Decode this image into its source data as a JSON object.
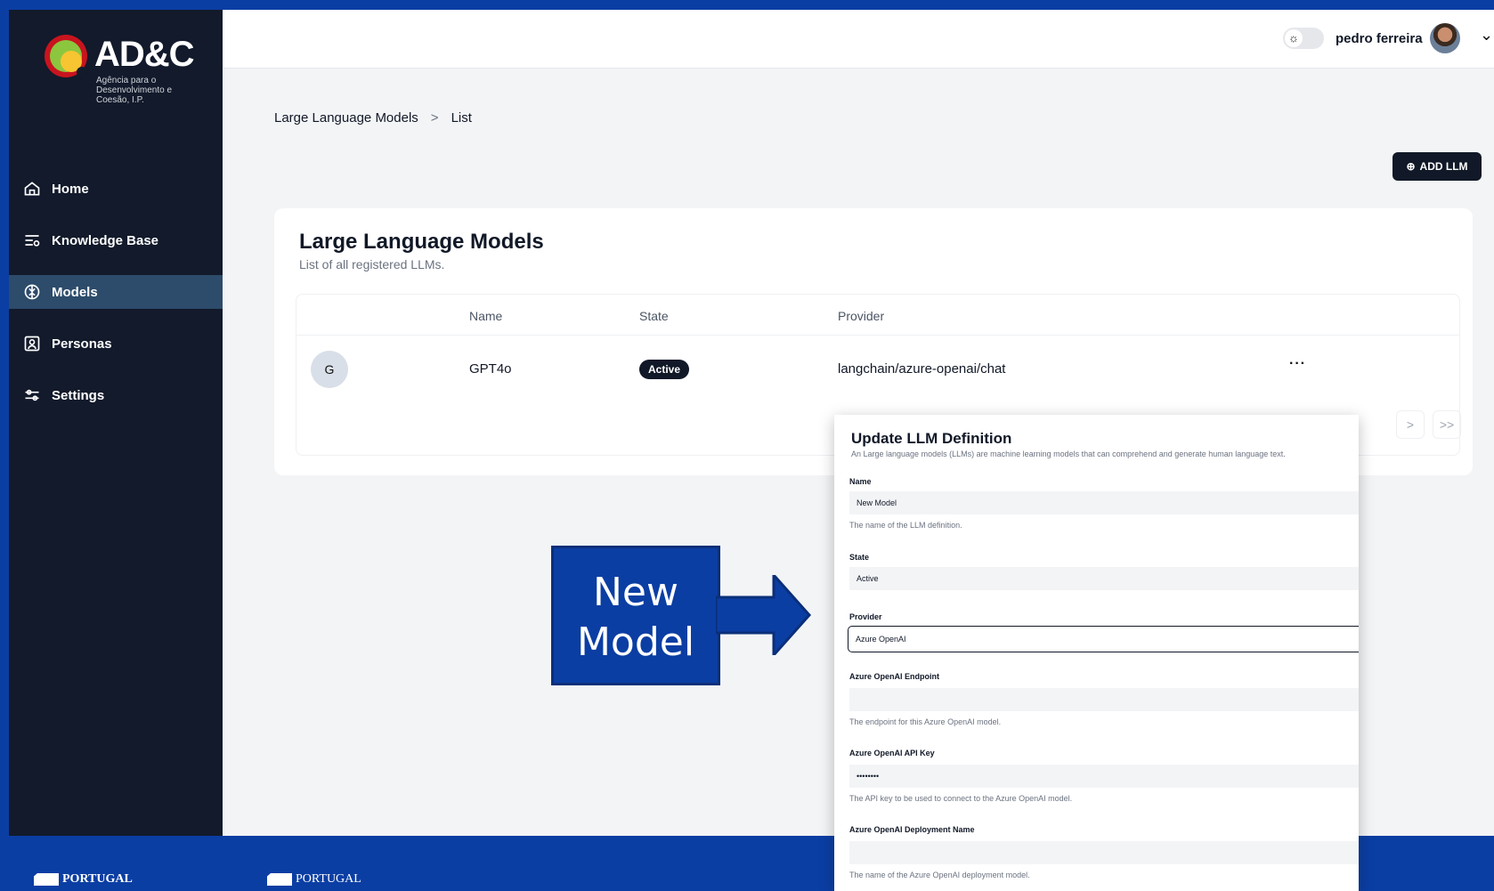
{
  "logo": {
    "name": "AD&C",
    "subtitle": "Agência para o Desenvolvimento e Coesão, I.P."
  },
  "sidebar": {
    "items": [
      {
        "label": "Home",
        "icon": "home-icon"
      },
      {
        "label": "Knowledge Base",
        "icon": "search-list-icon"
      },
      {
        "label": "Models",
        "icon": "brain-icon",
        "active": true
      },
      {
        "label": "Personas",
        "icon": "persona-icon"
      },
      {
        "label": "Settings",
        "icon": "sliders-icon"
      }
    ]
  },
  "header": {
    "user_name": "pedro ferreira",
    "theme_icon": "sun-icon"
  },
  "breadcrumb": {
    "parent": "Large Language Models",
    "separator": ">",
    "current": "List"
  },
  "add_button_label": "ADD LLM",
  "card": {
    "title": "Large Language Models",
    "subtitle": "List of all registered LLMs.",
    "columns": [
      "Name",
      "State",
      "Provider"
    ],
    "rows": [
      {
        "initial": "G",
        "name": "GPT4o",
        "state": "Active",
        "provider": "langchain/azure-openai/chat",
        "actions": "···"
      }
    ],
    "pager": {
      "next": ">",
      "last": ">>"
    }
  },
  "callout": {
    "line1": "New",
    "line2": "Model"
  },
  "modal": {
    "title": "Update LLM Definition",
    "description": "An Large language models (LLMs) are machine learning models that can comprehend and generate human language text.",
    "name_label": "Name",
    "name_value": "New Model",
    "name_help": "The name of the LLM definition.",
    "state_label": "State",
    "state_value": "Active",
    "provider_label": "Provider",
    "provider_value": "Azure OpenAI",
    "endpoint_label": "Azure OpenAI Endpoint",
    "endpoint_value": "",
    "endpoint_help": "The endpoint for this Azure OpenAI model.",
    "apikey_label": "Azure OpenAI API Key",
    "apikey_value": "••••••••",
    "apikey_help": "The API key to be used to connect to the Azure OpenAI model.",
    "deployment_label": "Azure OpenAI Deployment Name",
    "deployment_value": "",
    "deployment_help": "The name of the Azure OpenAI deployment model."
  },
  "footer_logos": [
    "PORTUGAL",
    "PORTUGAL"
  ]
}
